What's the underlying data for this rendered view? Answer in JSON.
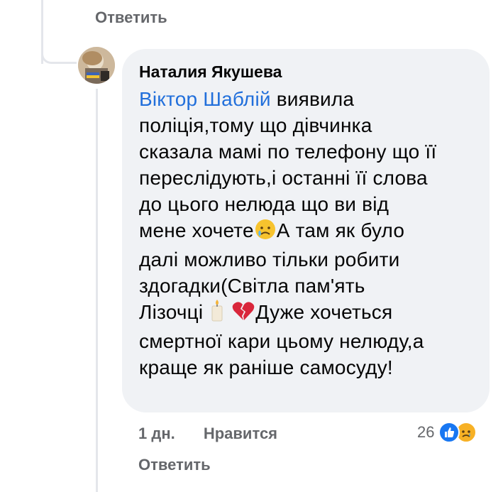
{
  "previous_comment": {
    "reply_label": "Ответить"
  },
  "comment": {
    "author": "Наталия Якушева",
    "mention": "Віктор Шаблій",
    "lines": [
      " виявила",
      "поліція,тому що дівчинка",
      "сказала мамі по телефону що її",
      "переслідують,і останні її слова",
      "до цього нелюда що ви від"
    ],
    "line6_a": "мене хочете",
    "line6_b": "А там як було",
    "line7": "далі можливо тільки робити",
    "line8": "здогадки(Світла пам'ять",
    "line9_a": "Лізочці",
    "line9_b": "Дуже хочеться",
    "line10": "смертної кари цьому нелюду,а",
    "line11": "краще як раніше самосуду!",
    "time": "1 дн.",
    "like_label": "Нравится",
    "reaction_count": "26",
    "reactions": [
      "like-icon",
      "sad-icon"
    ],
    "reply_label": "Ответить"
  },
  "colors": {
    "mention": "#216fdb",
    "meta": "#65676b",
    "bubble": "#f0f2f5",
    "like": "#1877f2",
    "sad": "#f7b125"
  }
}
